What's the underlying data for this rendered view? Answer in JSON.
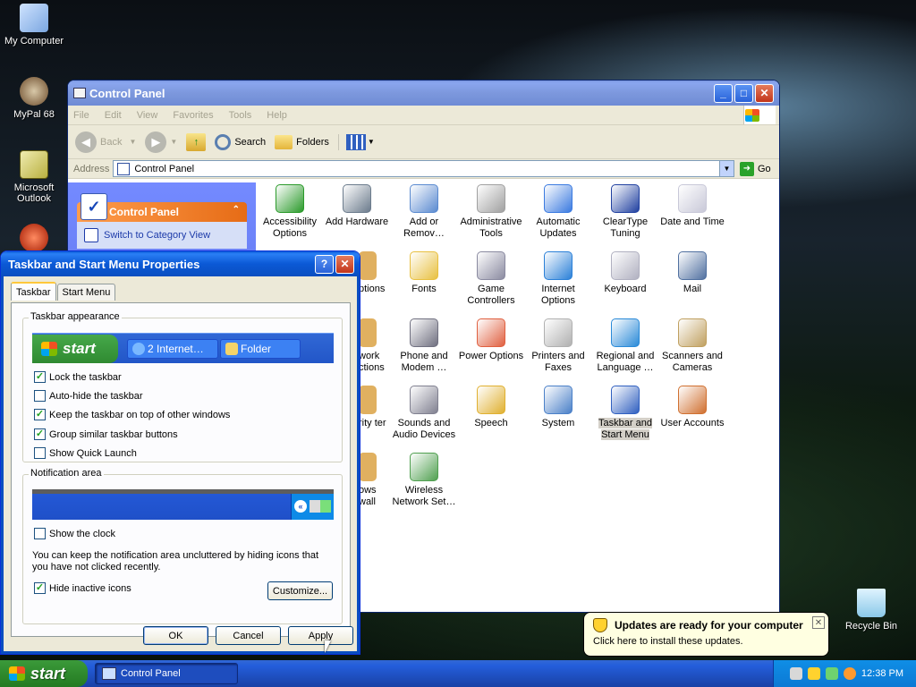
{
  "desktop": {
    "icons": [
      {
        "label": "My Computer",
        "color": "#9ec5f7"
      },
      {
        "label": "MyPal 68",
        "color": "#7b5a3a"
      },
      {
        "label": "Microsoft Outlook",
        "color": "#d8d070"
      },
      {
        "label": "Recycle Bin",
        "color": "#7fc3e8"
      }
    ]
  },
  "control_panel": {
    "title": "Control Panel",
    "menu": [
      "File",
      "Edit",
      "View",
      "Favorites",
      "Tools",
      "Help"
    ],
    "toolbar": {
      "back": "Back",
      "search": "Search",
      "folders": "Folders"
    },
    "address_label": "Address",
    "address_value": "Control Panel",
    "go_label": "Go",
    "taskpane": {
      "title": "Control Panel",
      "switch_link": "Switch to Category View"
    },
    "items": [
      {
        "label": "Accessibility Options",
        "color": "#2a9a2a"
      },
      {
        "label": "Add Hardware",
        "color": "#6b7b8c"
      },
      {
        "label": "Add or Remov…",
        "color": "#5a8ad0"
      },
      {
        "label": "Administrative Tools",
        "color": "#a0a0a0"
      },
      {
        "label": "Automatic Updates",
        "color": "#3a7ae0"
      },
      {
        "label": "ClearType Tuning",
        "color": "#2040a0"
      },
      {
        "label": "Date and Time",
        "color": "#c8c8d8"
      },
      {
        "label": "Fonts",
        "color": "#e8c040"
      },
      {
        "label": "Game Controllers",
        "color": "#8a8aa0"
      },
      {
        "label": "Internet Options",
        "color": "#2a80d8"
      },
      {
        "label": "Keyboard",
        "color": "#b0b0c0"
      },
      {
        "label": "Mail",
        "color": "#5070a0"
      },
      {
        "label": "Phone and Modem …",
        "color": "#707080"
      },
      {
        "label": "Power Options",
        "color": "#e06040"
      },
      {
        "label": "Printers and Faxes",
        "color": "#b0b0b0"
      },
      {
        "label": "Regional and Language …",
        "color": "#2a8ad8"
      },
      {
        "label": "Scanners and Cameras",
        "color": "#c0a060"
      },
      {
        "label": "Sounds and Audio Devices",
        "color": "#808090"
      },
      {
        "label": "Speech",
        "color": "#e0b030"
      },
      {
        "label": "System",
        "color": "#4a80c8"
      },
      {
        "label": "Taskbar and Start Menu",
        "color": "#3060c0"
      },
      {
        "label": "User Accounts",
        "color": "#d07030"
      },
      {
        "label": "Wireless Network Set…",
        "color": "#50a050"
      }
    ],
    "partial_labels": [
      "ptions",
      "work ctions",
      "rity ter",
      "ows wall"
    ]
  },
  "dialog": {
    "title": "Taskbar and Start Menu Properties",
    "tabs": [
      "Taskbar",
      "Start Menu"
    ],
    "appearance_group": "Taskbar appearance",
    "preview": {
      "start": "start",
      "btn1": "2 Internet…",
      "btn2": "Folder"
    },
    "options": [
      {
        "label": "Lock the taskbar",
        "checked": true
      },
      {
        "label": "Auto-hide the taskbar",
        "checked": false
      },
      {
        "label": "Keep the taskbar on top of other windows",
        "checked": true
      },
      {
        "label": "Group similar taskbar buttons",
        "checked": true
      },
      {
        "label": "Show Quick Launch",
        "checked": false
      }
    ],
    "notification_group": "Notification area",
    "show_clock": {
      "label": "Show the clock",
      "checked": false
    },
    "description": "You can keep the notification area uncluttered by hiding icons that you have not clicked recently.",
    "hide_inactive": {
      "label": "Hide inactive icons",
      "checked": true
    },
    "customize": "Customize...",
    "ok": "OK",
    "cancel": "Cancel",
    "apply": "Apply"
  },
  "balloon": {
    "title": "Updates are ready for your computer",
    "text": "Click here to install these updates."
  },
  "taskbar": {
    "start": "start",
    "task": "Control Panel",
    "clock": "12:38 PM"
  }
}
